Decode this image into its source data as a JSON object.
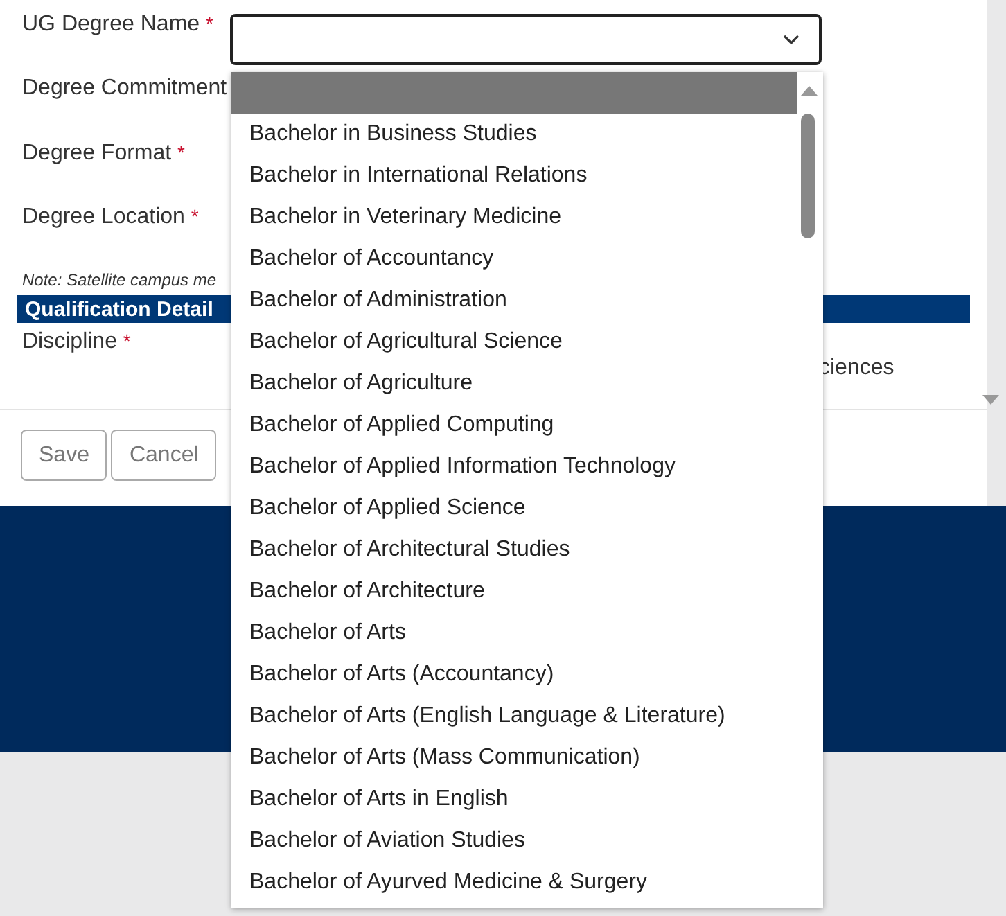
{
  "form": {
    "fields": [
      {
        "label": "UG Degree Name",
        "required_mark": "*"
      },
      {
        "label": "Degree Commitment"
      },
      {
        "label": "Degree Format",
        "required_mark": "*"
      },
      {
        "label": "Degree Location",
        "required_mark": "*"
      }
    ],
    "note": "Note: Satellite campus me",
    "section_title": "Qualification Detail",
    "discipline": {
      "label": "Discipline",
      "required_mark": "*",
      "value": "ciences"
    },
    "buttons": [
      "Save",
      "Cancel"
    ]
  },
  "dropdown": {
    "options": [
      {
        "selected": true
      },
      {
        "label": "Bachelor in Business Studies",
        "selected": false
      },
      {
        "label": "Bachelor in International Relations",
        "selected": false
      },
      {
        "label": "Bachelor in Veterinary Medicine",
        "selected": false
      },
      {
        "label": "Bachelor of Accountancy",
        "selected": false
      },
      {
        "label": "Bachelor of Administration",
        "selected": false
      },
      {
        "label": "Bachelor of Agricultural Science",
        "selected": false
      },
      {
        "label": "Bachelor of Agriculture",
        "selected": false
      },
      {
        "label": "Bachelor of Applied Computing",
        "selected": false
      },
      {
        "label": "Bachelor of Applied Information Technology",
        "selected": false
      },
      {
        "label": "Bachelor of Applied Science",
        "selected": false
      },
      {
        "label": "Bachelor of Architectural Studies",
        "selected": false
      },
      {
        "label": "Bachelor of Architecture",
        "selected": false
      },
      {
        "label": "Bachelor of Arts",
        "selected": false
      },
      {
        "label": "Bachelor of Arts (Accountancy)",
        "selected": false
      },
      {
        "label": "Bachelor of Arts (English Language & Literature)",
        "selected": false
      },
      {
        "label": "Bachelor of Arts (Mass Communication)",
        "selected": false
      },
      {
        "label": "Bachelor of Arts in English",
        "selected": false
      },
      {
        "label": "Bachelor of Aviation Studies",
        "selected": false
      },
      {
        "label": "Bachelor of Ayurved Medicine & Surgery",
        "selected": false
      }
    ]
  }
}
